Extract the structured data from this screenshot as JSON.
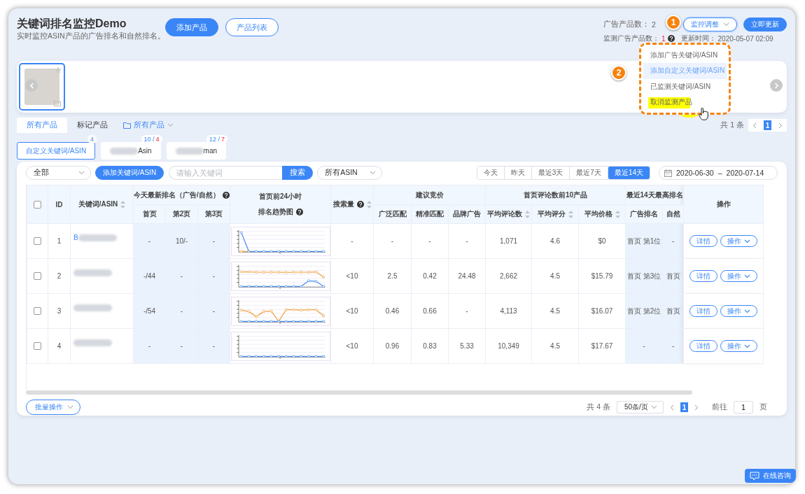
{
  "header": {
    "title": "关键词排名监控Demo",
    "subtitle": "实时监控ASIN产品的广告排名和自然排名。",
    "buttons": [
      {
        "label": "添加产品",
        "kind": "primary"
      },
      {
        "label": "产品列表",
        "kind": "outline"
      }
    ]
  },
  "stats": {
    "ad_products": {
      "label": "广告产品数：",
      "value": "2"
    },
    "monitored": {
      "label": "监测广告产品数：",
      "value": "1"
    },
    "updated": {
      "label": "更新时间：",
      "value": "2020-05-07 02:09"
    }
  },
  "monitor_button": {
    "label": "监控调整",
    "expanded": true
  },
  "update_button": {
    "label": "立即更新"
  },
  "monitor_menu": [
    {
      "label": "添加广告关键词/ASIN",
      "selected": false,
      "marked": false
    },
    {
      "label": "添加自定义关键词/ASIN",
      "selected": true,
      "marked": false
    },
    {
      "label": "已监测关键词/ASIN",
      "selected": false,
      "marked": false
    },
    {
      "label": "取消监测产品",
      "selected": false,
      "marked": true
    }
  ],
  "step_markers": [
    "1",
    "2"
  ],
  "products": [
    {
      "selected": true
    }
  ],
  "product_filters": [
    {
      "label": "所有产品",
      "selected": true
    },
    {
      "label": "标记产品",
      "selected": false
    }
  ],
  "folder_filter": {
    "label": "所有产品"
  },
  "product_pager": {
    "total": "共 1 条",
    "pages": [
      {
        "label": "1",
        "selected": true
      }
    ]
  },
  "keyword_tabs": [
    {
      "label": "自定义关键词/ASIN",
      "selected": true,
      "redacted": false,
      "badge": [
        {
          "text": "4",
          "kind": "total"
        }
      ]
    },
    {
      "label": "Asin",
      "selected": false,
      "redacted": true,
      "badge": [
        {
          "text": "10 /",
          "kind": "total"
        },
        {
          "text": "4",
          "kind": "new"
        }
      ]
    },
    {
      "label": "man",
      "selected": false,
      "redacted": true,
      "badge": [
        {
          "text": "12 /",
          "kind": "total"
        },
        {
          "text": "7",
          "kind": "new"
        }
      ]
    }
  ],
  "toolbar": {
    "scope_select": "全部",
    "add_button": "添加关键词/ASIN",
    "search_placeholder": "请输入关键词",
    "search_button": "搜索",
    "asin_select": "所有ASIN"
  },
  "date_tabs": [
    {
      "label": "今天",
      "selected": false
    },
    {
      "label": "昨天",
      "selected": false
    },
    {
      "label": "最近3天",
      "selected": false
    },
    {
      "label": "最近7天",
      "selected": false
    },
    {
      "label": "最近14天",
      "selected": true
    }
  ],
  "date_range": {
    "start": "2020-06-30",
    "separator": "–",
    "end": "2020-07-14"
  },
  "select_all": {
    "checked": false
  },
  "table": {
    "columns": {
      "id": "ID",
      "keyword": "关键词/ASIN",
      "today_rank": "今天最新排名（广告/自然）",
      "today_rank_sub": [
        "首页",
        "第2页",
        "第3页"
      ],
      "trend": [
        "首页前24小时",
        "排名趋势图"
      ],
      "search_volume": "搜索量",
      "bid": "建议竞价",
      "bid_sub": [
        "广泛匹配",
        "精准匹配",
        "品牌广告"
      ],
      "top10": "首页评论数前10产品",
      "top10_sub": [
        "平均评论数",
        "平均评分",
        "平均价格"
      ],
      "best_rank": "最近14天最高排名",
      "best_rank_sub": [
        "广告排名",
        "自然"
      ],
      "actions": "操作"
    },
    "rows": [
      {
        "checked": false,
        "id": "1",
        "keyword": "B",
        "redacted": true,
        "ranks": [
          "-",
          "10/-",
          "-"
        ],
        "search_volume": "-",
        "bids": [
          "-",
          "-",
          "-"
        ],
        "top10": [
          "1,071",
          "4.6",
          "$0"
        ],
        "best": [
          "首页 第1位",
          "-"
        ],
        "details": "详情",
        "more": "操作"
      },
      {
        "checked": false,
        "id": "2",
        "redacted": true,
        "ranks": [
          "-/44",
          "-",
          "-"
        ],
        "search_volume": "<10",
        "bids": [
          "2.5",
          "0.42",
          "24.48"
        ],
        "top10": [
          "2,662",
          "4.5",
          "$15.79"
        ],
        "best": [
          "首页 第3位",
          "首页"
        ],
        "details": "详情",
        "more": "操作"
      },
      {
        "checked": false,
        "id": "3",
        "redacted": true,
        "ranks": [
          "-/54",
          "-",
          "-"
        ],
        "search_volume": "<10",
        "bids": [
          "0.46",
          "0.66",
          "-"
        ],
        "top10": [
          "4,113",
          "4.5",
          "$16.07"
        ],
        "best": [
          "首页 第2位",
          "首页"
        ],
        "details": "详情",
        "more": "操作"
      },
      {
        "checked": false,
        "id": "4",
        "redacted": true,
        "ranks": [
          "-",
          "-",
          "-"
        ],
        "search_volume": "<10",
        "bids": [
          "0.96",
          "0.83",
          "5.33"
        ],
        "top10": [
          "10,349",
          "4.5",
          "$17.67"
        ],
        "best": [
          "-",
          "-"
        ],
        "details": "详情",
        "more": "操作"
      }
    ]
  },
  "bulk_button": "批量操作",
  "table_pager": {
    "total": "共 4 条",
    "page_size": "50条/页",
    "pages": [
      {
        "label": "1",
        "selected": true
      }
    ],
    "goto_label": "前往",
    "goto_value": "1",
    "goto_unit": "页"
  },
  "chat_button": "在线咨询"
}
